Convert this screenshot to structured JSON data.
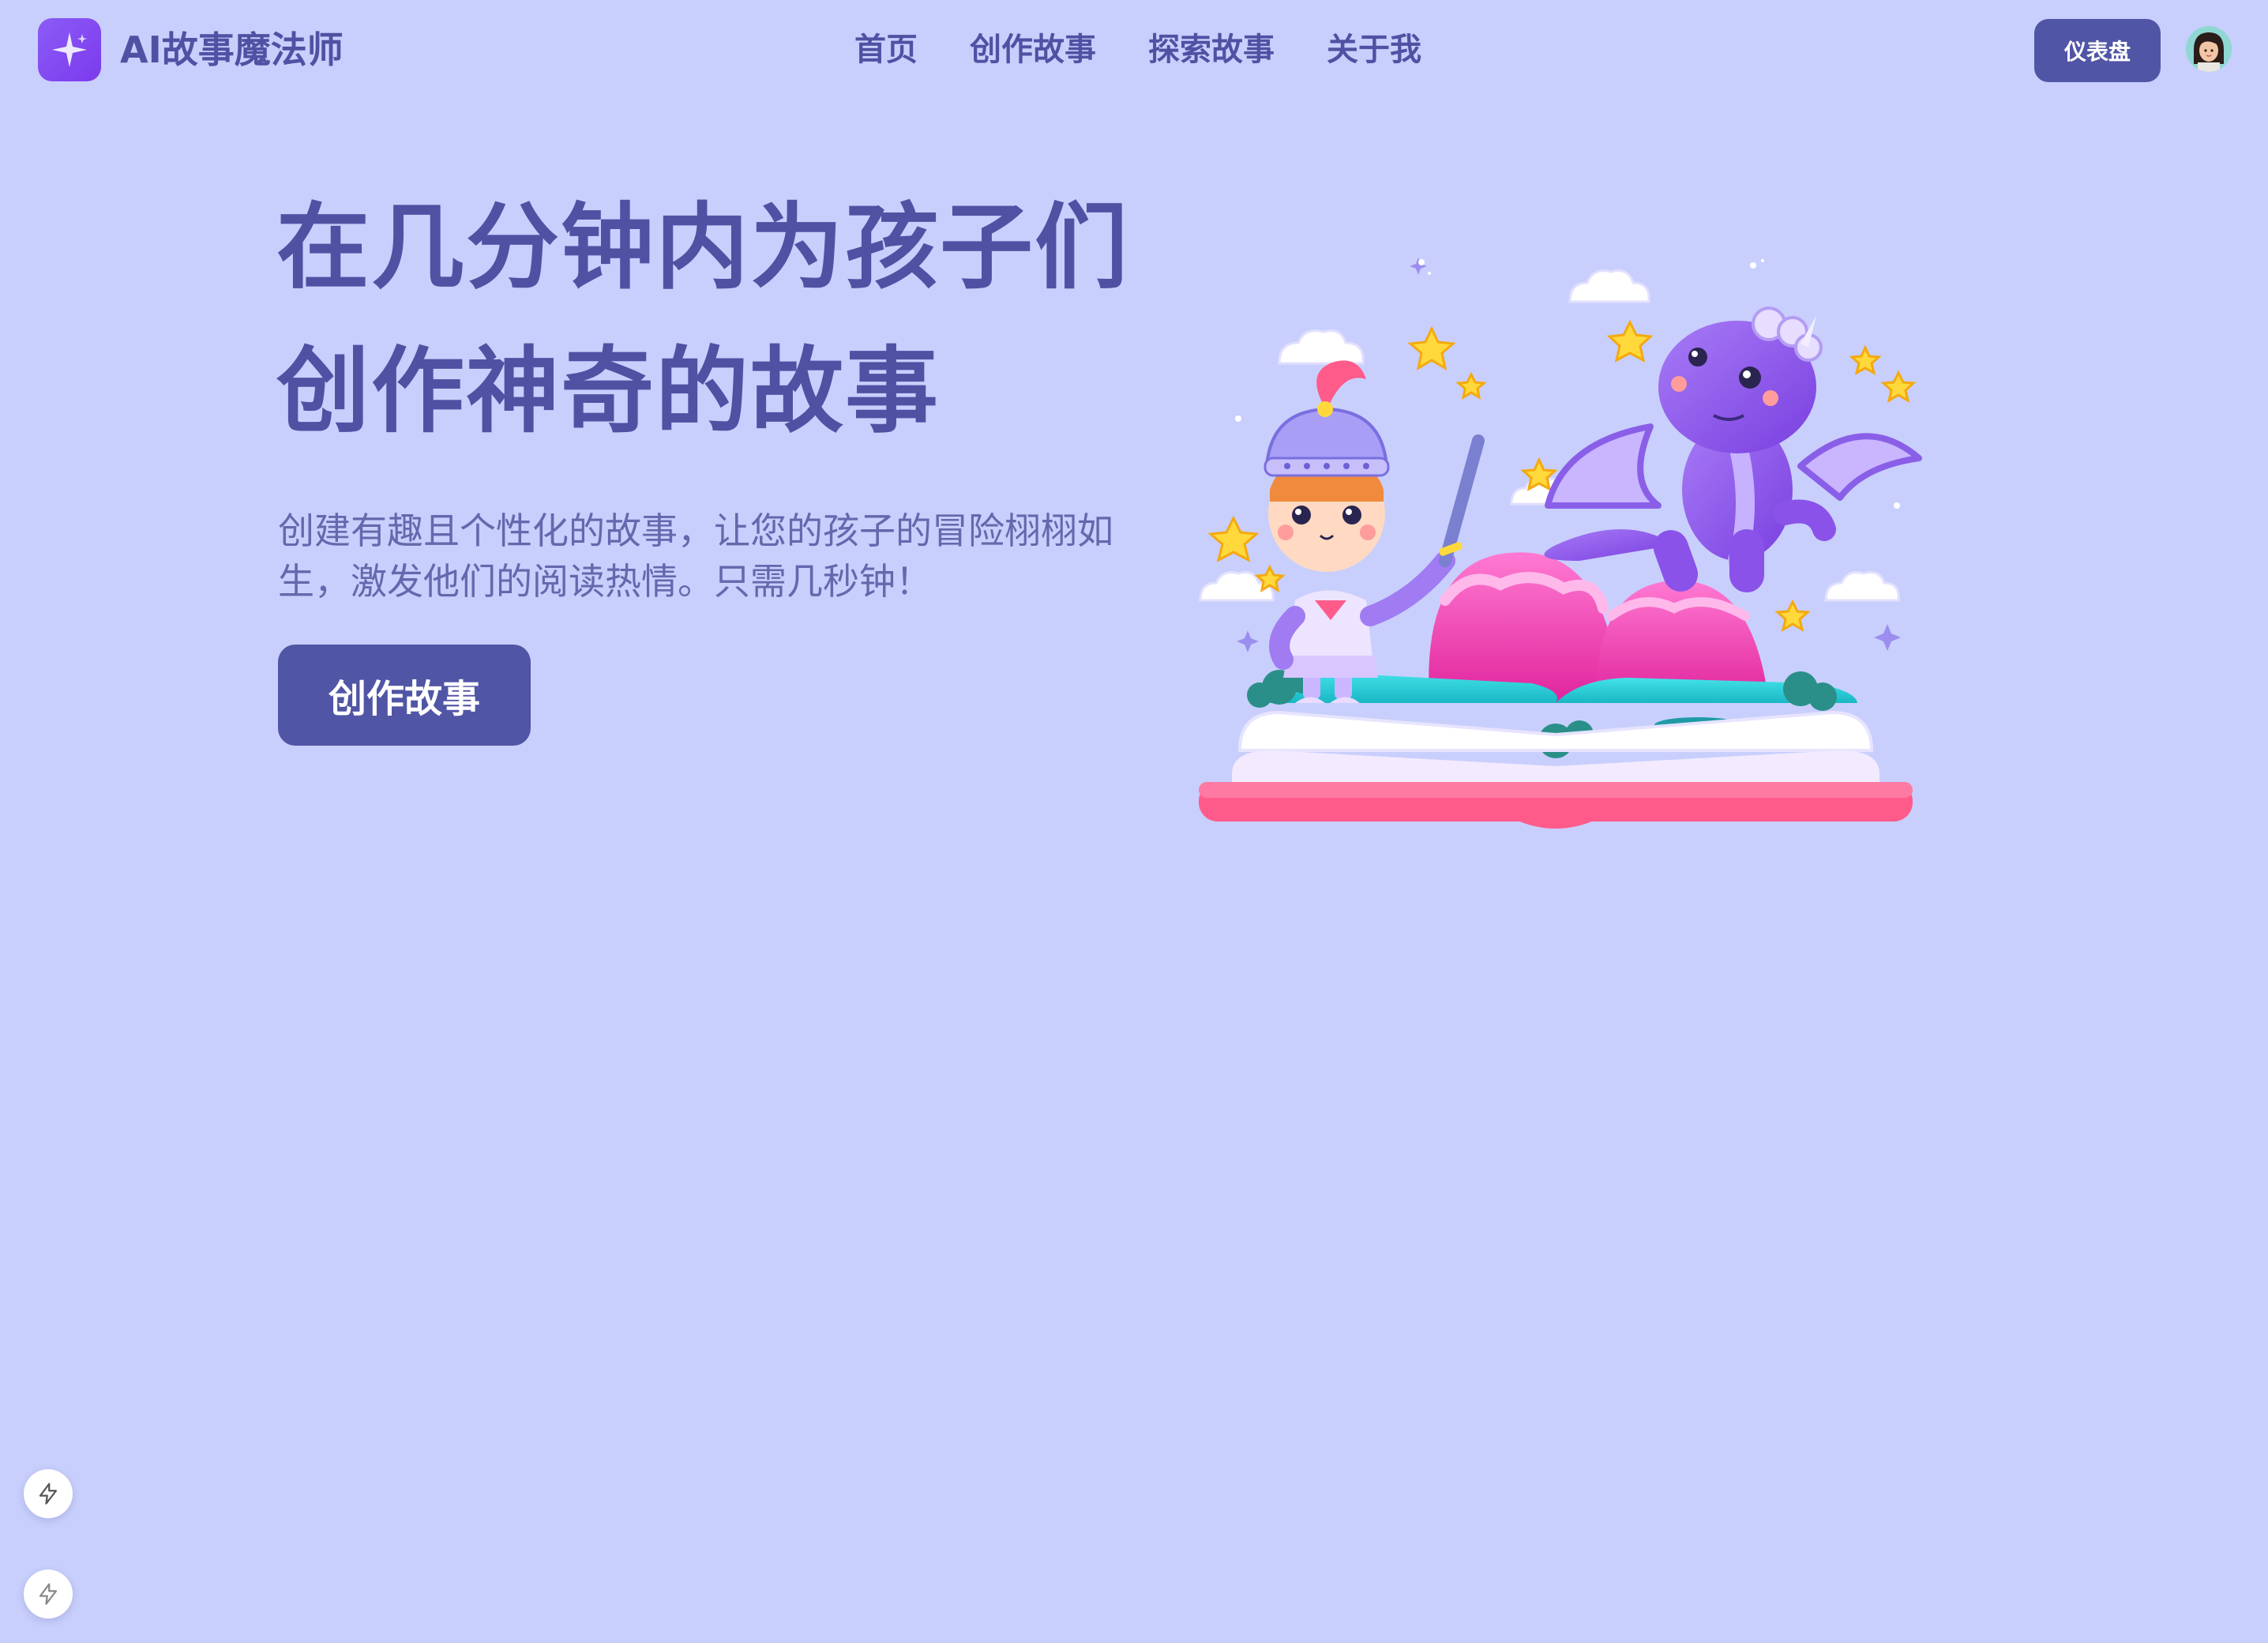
{
  "header": {
    "brand": "AI故事魔法师",
    "logo_icon": "sparkle-icon",
    "nav": [
      "首页",
      "创作故事",
      "探索故事",
      "关于我"
    ],
    "dashboard_label": "仪表盘",
    "avatar_icon": "user-avatar"
  },
  "hero": {
    "title_line1": "在几分钟内为孩子们",
    "title_line2": "创作神奇的故事",
    "subtitle": "创建有趣且个性化的故事，让您的孩子的冒险栩栩如生，激发他们的阅读热情。只需几秒钟！",
    "cta_label": "创作故事",
    "illustration": "storybook-knight-dragon-illustration"
  },
  "floating_buttons": [
    "lightning-icon",
    "lightning-icon"
  ],
  "colors": {
    "background": "#c8cffc",
    "primary": "#5155a5",
    "text": "#4f52a3",
    "logo": "#8b5cf6"
  }
}
